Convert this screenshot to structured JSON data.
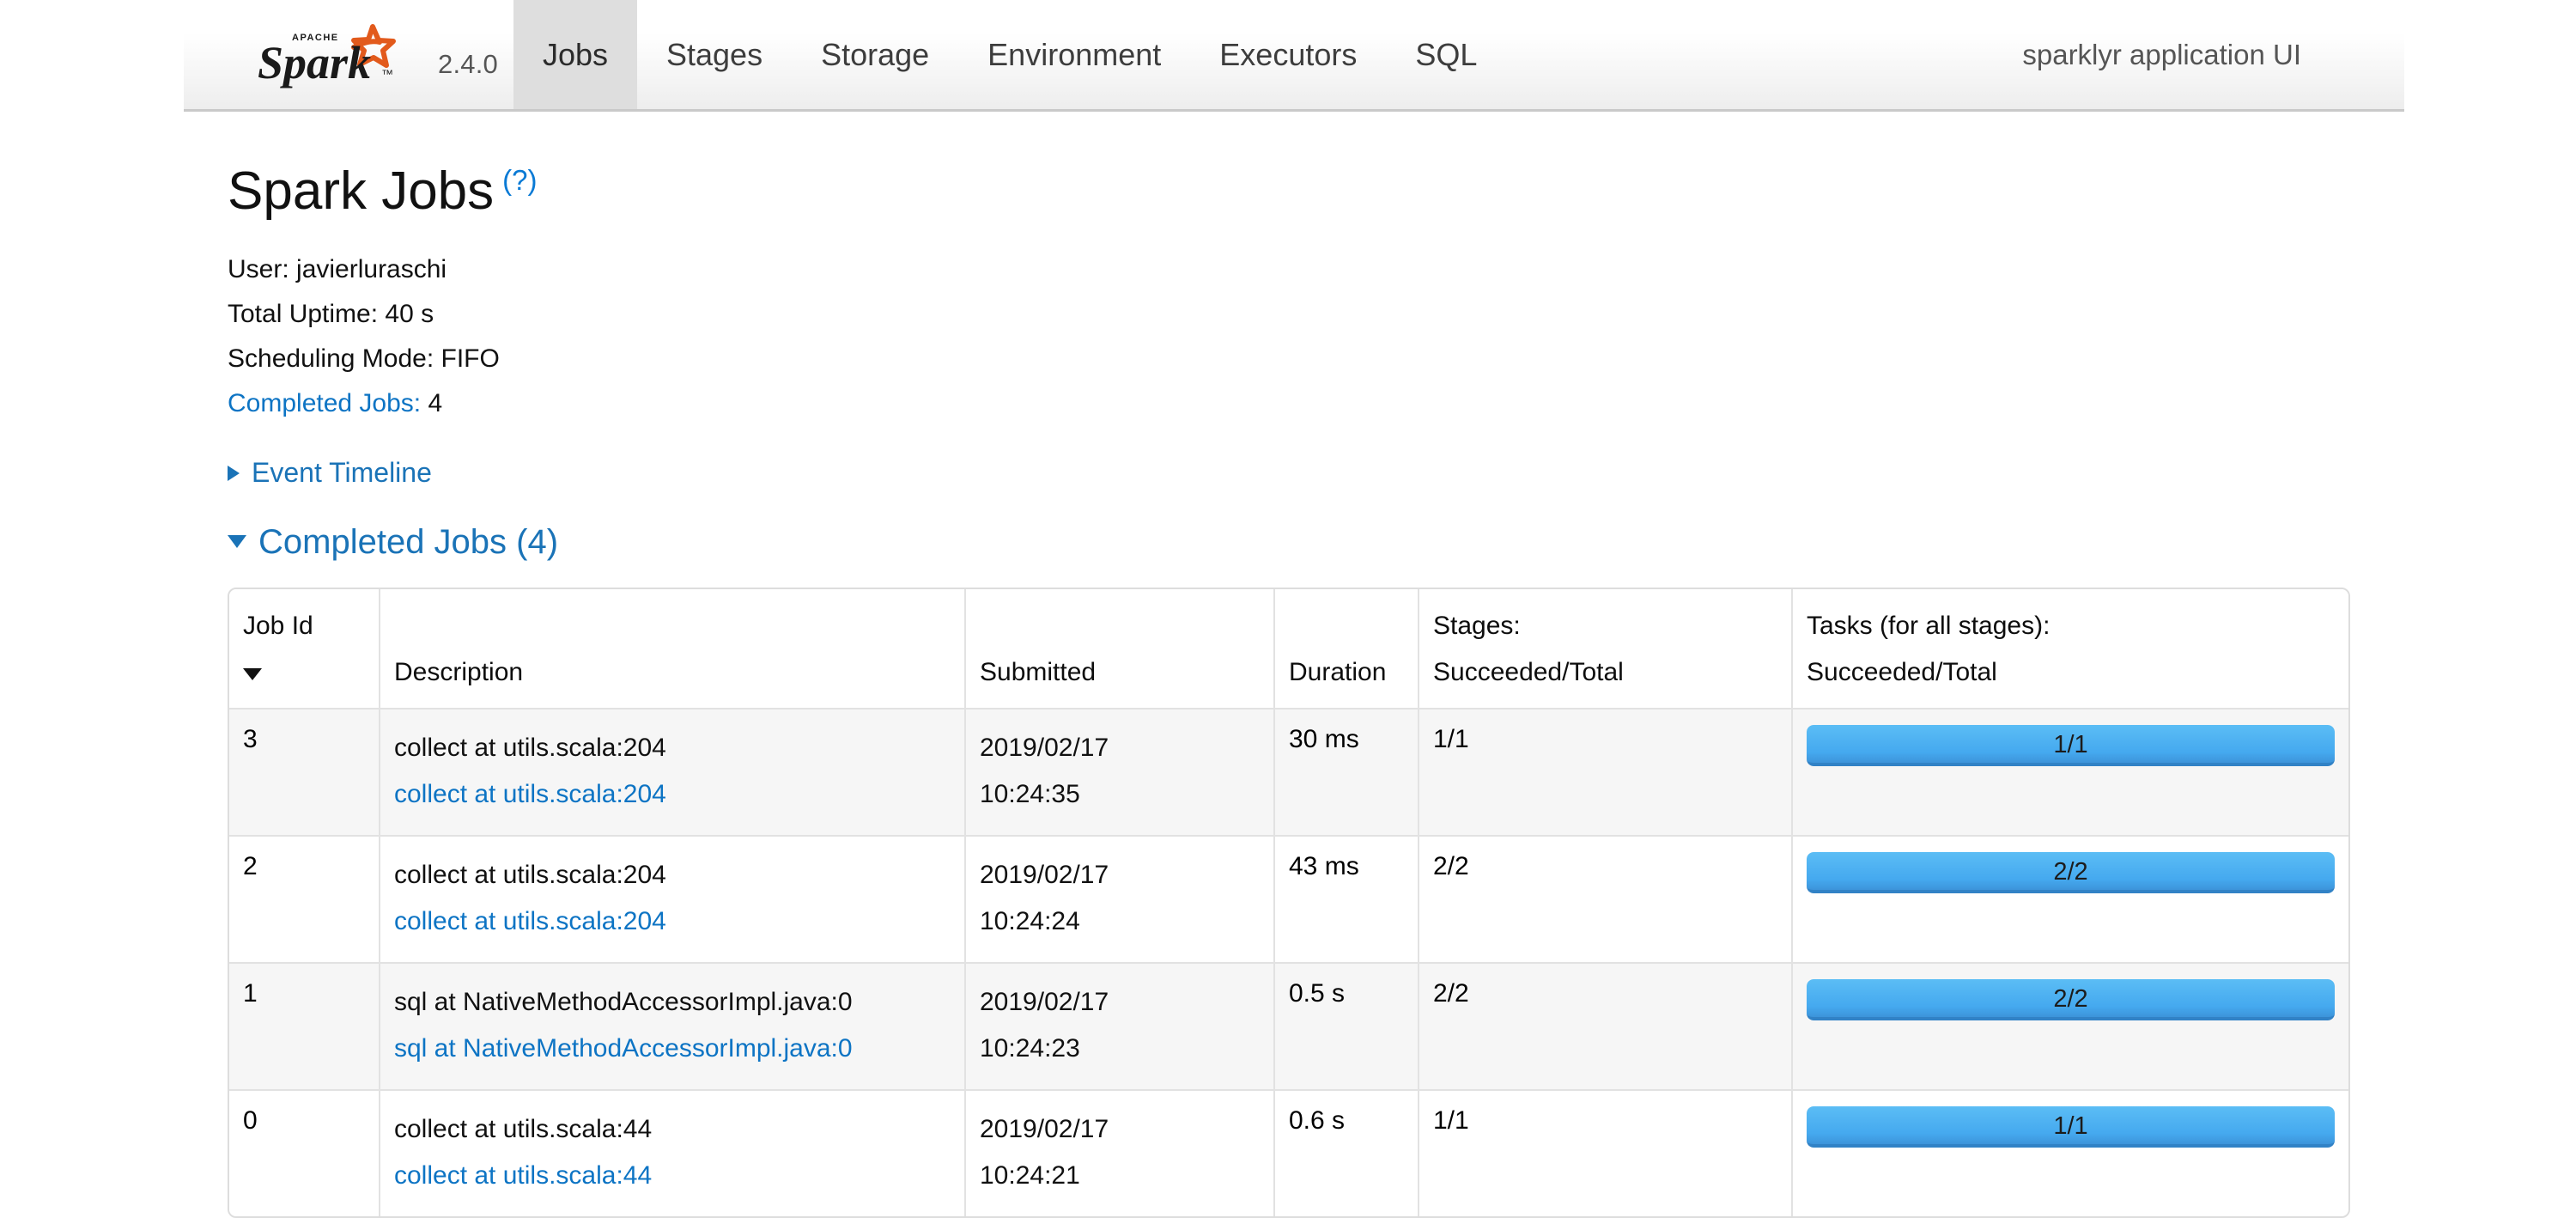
{
  "navbar": {
    "brand_name": "Apache Spark",
    "version": "2.4.0",
    "tabs": [
      {
        "label": "Jobs",
        "active": true
      },
      {
        "label": "Stages",
        "active": false
      },
      {
        "label": "Storage",
        "active": false
      },
      {
        "label": "Environment",
        "active": false
      },
      {
        "label": "Executors",
        "active": false
      },
      {
        "label": "SQL",
        "active": false
      }
    ],
    "app_name": "sparklyr application UI"
  },
  "page": {
    "title": "Spark Jobs",
    "help_label": "(?)",
    "summary": {
      "user_label": "User:",
      "user_value": "javierluraschi",
      "uptime_label": "Total Uptime:",
      "uptime_value": "40 s",
      "scheduling_label": "Scheduling Mode:",
      "scheduling_value": "FIFO",
      "completed_label": "Completed Jobs:",
      "completed_value": "4"
    },
    "event_timeline_label": "Event Timeline",
    "completed_section_label": "Completed Jobs (4)"
  },
  "table": {
    "headers": {
      "job_id": "Job Id",
      "description": "Description",
      "submitted": "Submitted",
      "duration": "Duration",
      "stages_line1": "Stages:",
      "stages_line2": "Succeeded/Total",
      "tasks_line1": "Tasks (for all stages):",
      "tasks_line2": "Succeeded/Total"
    },
    "rows": [
      {
        "job_id": "3",
        "description": "collect at utils.scala:204",
        "description_link": "collect at utils.scala:204",
        "submitted_date": "2019/02/17",
        "submitted_time": "10:24:35",
        "duration": "30 ms",
        "stages": "1/1",
        "tasks": "1/1",
        "tasks_percent": 100
      },
      {
        "job_id": "2",
        "description": "collect at utils.scala:204",
        "description_link": "collect at utils.scala:204",
        "submitted_date": "2019/02/17",
        "submitted_time": "10:24:24",
        "duration": "43 ms",
        "stages": "2/2",
        "tasks": "2/2",
        "tasks_percent": 100
      },
      {
        "job_id": "1",
        "description": "sql at NativeMethodAccessorImpl.java:0",
        "description_link": "sql at NativeMethodAccessorImpl.java:0",
        "submitted_date": "2019/02/17",
        "submitted_time": "10:24:23",
        "duration": "0.5 s",
        "stages": "2/2",
        "tasks": "2/2",
        "tasks_percent": 100
      },
      {
        "job_id": "0",
        "description": "collect at utils.scala:44",
        "description_link": "collect at utils.scala:44",
        "submitted_date": "2019/02/17",
        "submitted_time": "10:24:21",
        "duration": "0.6 s",
        "stages": "1/1",
        "tasks": "1/1",
        "tasks_percent": 100
      }
    ]
  },
  "colors": {
    "link": "#0d74c4",
    "progress_blue": "#45a9ef",
    "active_tab_bg": "#dedede"
  }
}
